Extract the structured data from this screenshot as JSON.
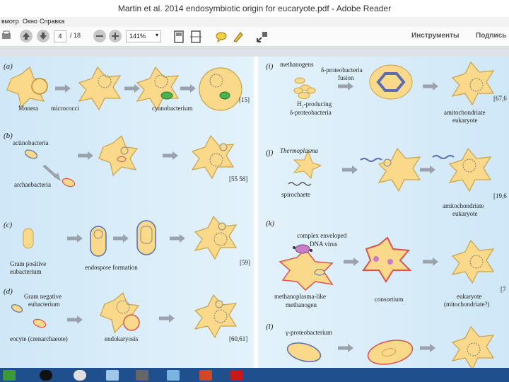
{
  "window": {
    "title": "Martin et al. 2014 endosymbiotic origin for eucaryote.pdf - Adobe Reader"
  },
  "menu": {
    "items": [
      "вмотр",
      "Окно",
      "Справка"
    ]
  },
  "toolbar": {
    "page_current": "4",
    "page_total": "/ 18",
    "zoom": "141%",
    "tools_label": "Инструменты",
    "sign_label": "Подпись"
  },
  "panels": {
    "a": {
      "label": "(a)",
      "captions": [
        "Monera",
        "micrococci",
        "cyanobacterium"
      ],
      "ref": "[15]"
    },
    "b": {
      "label": "(b)",
      "captions": [
        "actinobacteria",
        "archaebacteria"
      ],
      "ref": "[55 58]"
    },
    "c": {
      "label": "(c)",
      "captions": [
        "Gram positive",
        "eubacterium",
        "endospore formation"
      ],
      "ref": "[59]"
    },
    "d": {
      "label": "(d)",
      "captions": [
        "Gram negative",
        "eubacterium",
        "eocyte (crenarchaeote)",
        "endokaryosis"
      ],
      "ref": "[60,61]"
    },
    "i": {
      "label": "(i)",
      "captions": [
        "methanogens",
        "δ-proteobacteria",
        "fusion",
        "H₂-producing",
        "δ-proteobacteria",
        "amitochondriate",
        "eukaryote"
      ],
      "ref": "[67,6"
    },
    "j": {
      "label": "(j)",
      "captions": [
        "Thermoplasma",
        "spirochaete",
        "amitochondriate",
        "eukaryote"
      ],
      "ref": "[19,6"
    },
    "k": {
      "label": "(k)",
      "captions": [
        "complex enveloped",
        "DNA virus",
        "methanoplasma-like",
        "methanogen",
        "consortium",
        "eukaryote",
        "(mitochondriate?)"
      ],
      "ref": "[7"
    },
    "l": {
      "label": "(l)",
      "captions": [
        "γ-proteobacterium"
      ]
    }
  }
}
